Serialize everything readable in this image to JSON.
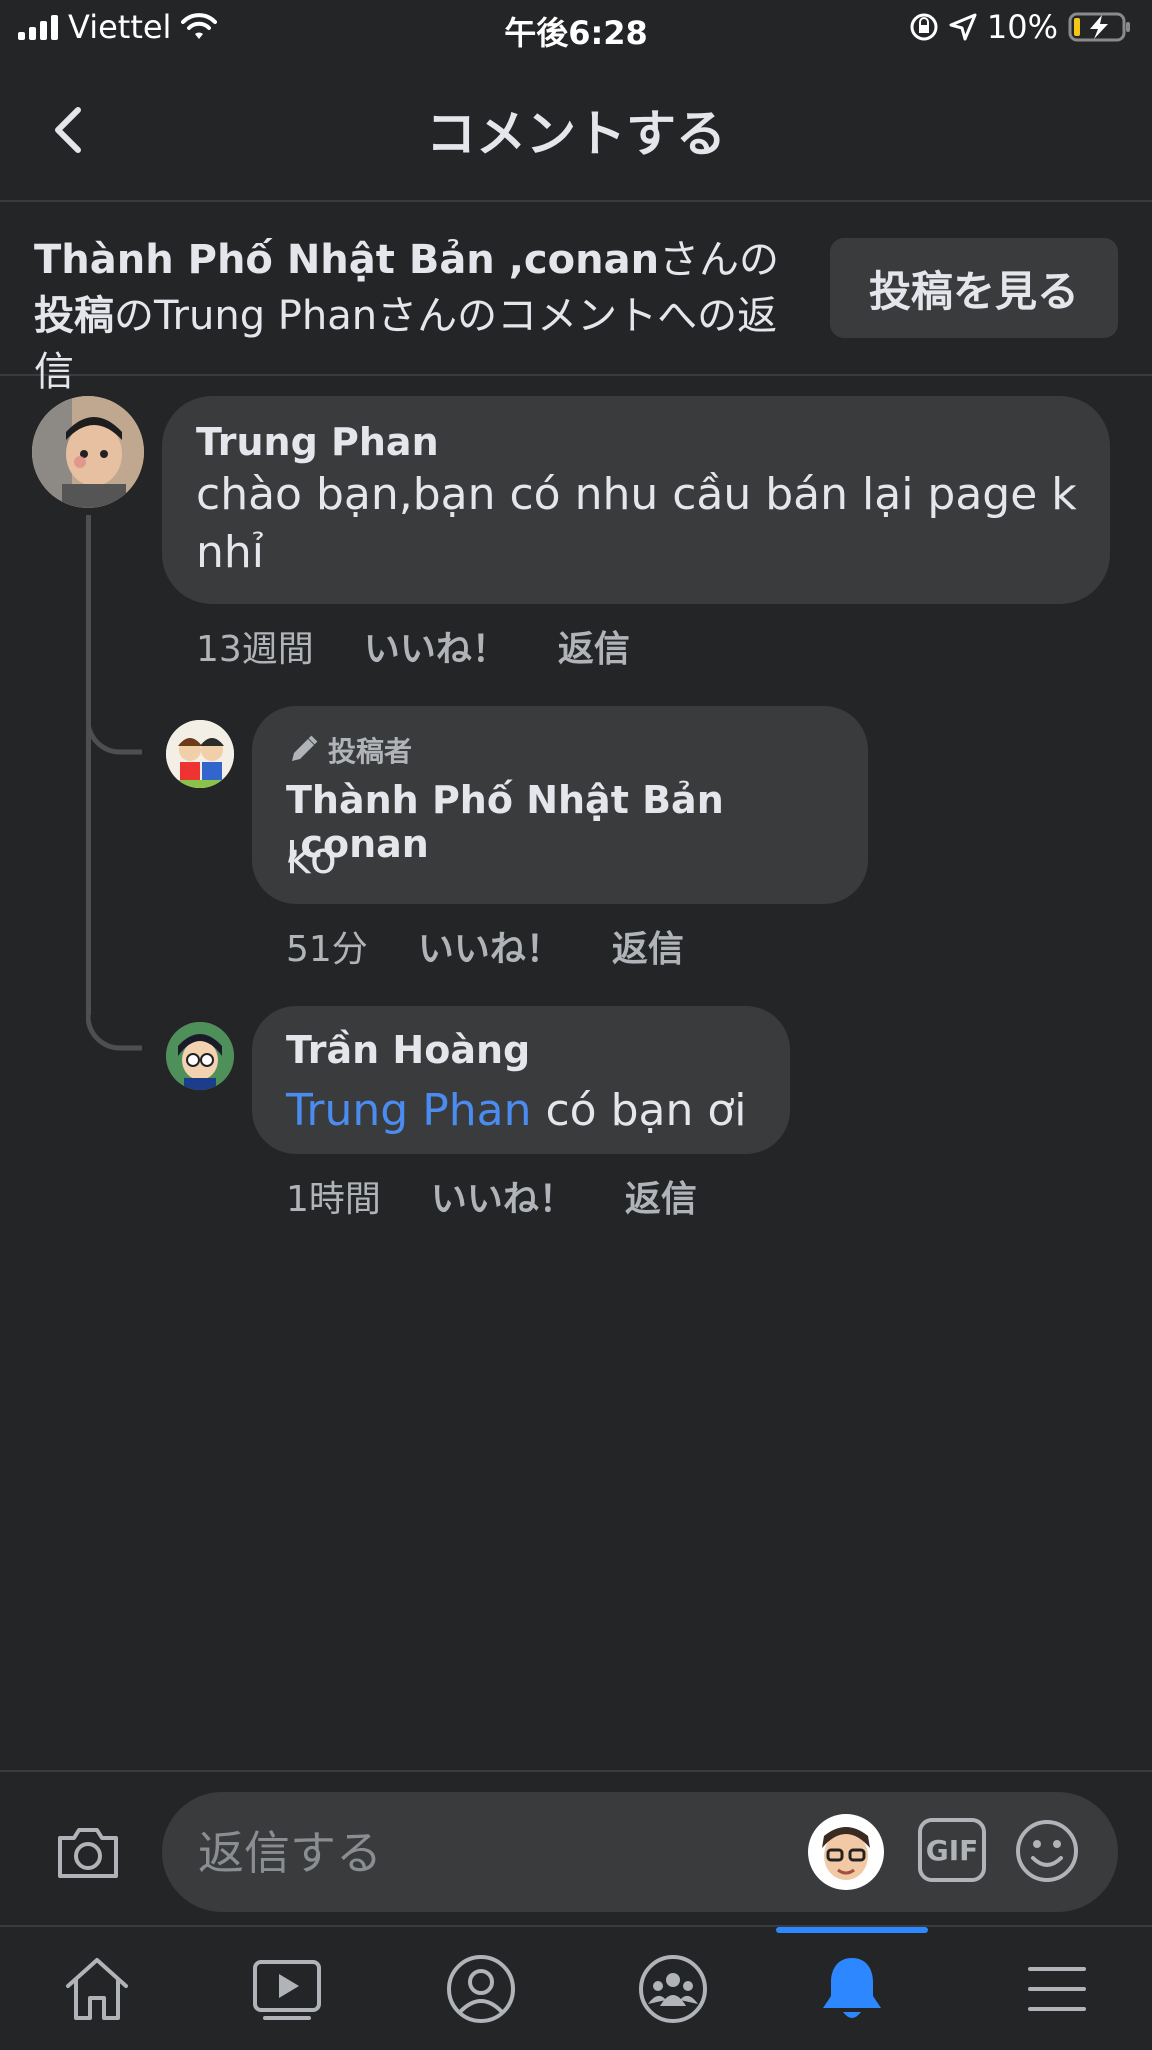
{
  "status": {
    "carrier": "Viettel",
    "time": "午後6:28",
    "battery": "10%"
  },
  "header": {
    "title": "コメントする"
  },
  "context": {
    "page_name": "Thành Phố Nhật Bản ,conan",
    "part1": "さんの",
    "bold1": "投稿",
    "part2": "の",
    "commenter": "Trung Phan",
    "part3": "さんのコメントへの返信",
    "view_post_label": "投稿を見る"
  },
  "comments": [
    {
      "author": "Trung Phan",
      "text": "chào bạn,bạn có nhu cầu bán lại page k nhỉ",
      "time": "13週間",
      "like": "いいね！",
      "reply": "返信"
    },
    {
      "badge": "投稿者",
      "author": "Thành Phố Nhật Bản ,conan",
      "text": "ko",
      "time": "51分",
      "like": "いいね！",
      "reply": "返信"
    },
    {
      "author": "Trần Hoàng",
      "mention": "Trung Phan",
      "text": "có bạn ơi",
      "time": "1時間",
      "like": "いいね！",
      "reply": "返信"
    }
  ],
  "composer": {
    "placeholder": "返信する",
    "gif_label": "GIF"
  },
  "colors": {
    "background": "#242526",
    "bubble": "#3a3b3c",
    "accent": "#2d88ff",
    "mention": "#4a8cf0"
  },
  "tabs": [
    "home-icon",
    "watch-icon",
    "profile-icon",
    "groups-icon",
    "notifications-icon",
    "menu-icon"
  ]
}
